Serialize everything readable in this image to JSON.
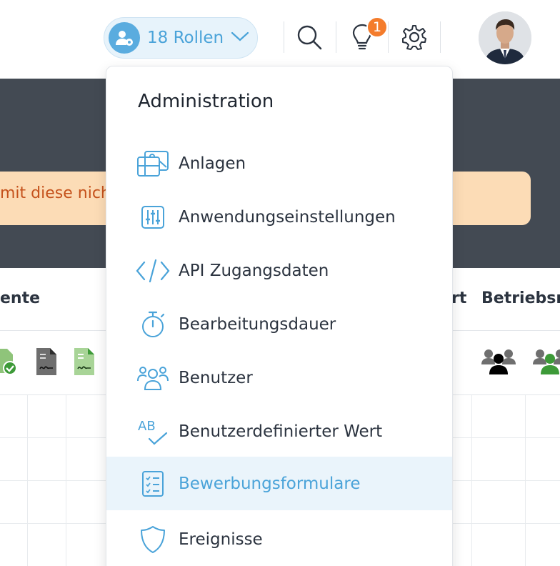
{
  "header": {
    "roles_label": "18 Rollen",
    "notification_count": "1"
  },
  "banner": {
    "warning_text": "mit diese nich"
  },
  "table": {
    "headers": [
      "ente",
      "rt",
      "Betriebsra"
    ]
  },
  "menu": {
    "title": "Administration",
    "active_index": 6,
    "items": [
      {
        "label": "Anlagen",
        "icon": "image-gallery-icon"
      },
      {
        "label": "Anwendungseinstellungen",
        "icon": "sliders-icon"
      },
      {
        "label": "API Zugangsdaten",
        "icon": "code-icon"
      },
      {
        "label": "Bearbeitungsdauer",
        "icon": "stopwatch-icon"
      },
      {
        "label": "Benutzer",
        "icon": "users-icon"
      },
      {
        "label": "Benutzerdefinierter Wert",
        "icon": "ab-check-icon"
      },
      {
        "label": "Bewerbungsformulare",
        "icon": "checklist-icon"
      },
      {
        "label": "Ereignisse",
        "icon": "shield-icon"
      }
    ]
  },
  "colors": {
    "accent": "#4aa3d9",
    "dark_band": "#434a53",
    "warning_bg": "#fcdcb6",
    "warning_text": "#c5521c",
    "badge": "#f47c2c",
    "active_bg": "#eaf4fb"
  }
}
